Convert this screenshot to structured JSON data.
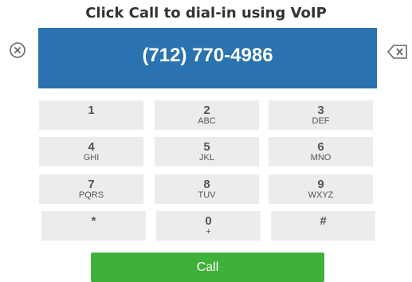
{
  "title": "Click Call to dial-in using VoIP",
  "display": {
    "number": "(712) 770-4986"
  },
  "keys": [
    {
      "digit": "1",
      "letters": ""
    },
    {
      "digit": "2",
      "letters": "ABC"
    },
    {
      "digit": "3",
      "letters": "DEF"
    },
    {
      "digit": "4",
      "letters": "GHI"
    },
    {
      "digit": "5",
      "letters": "JKL"
    },
    {
      "digit": "6",
      "letters": "MNO"
    },
    {
      "digit": "7",
      "letters": "PQRS"
    },
    {
      "digit": "8",
      "letters": "TUV"
    },
    {
      "digit": "9",
      "letters": "WXYZ"
    },
    {
      "digit": "*",
      "letters": ""
    },
    {
      "digit": "0",
      "letters": "+"
    },
    {
      "digit": "#",
      "letters": ""
    }
  ],
  "call_label": "Call",
  "icons": {
    "clear": "clear-circle-x-icon",
    "backspace": "backspace-icon"
  },
  "colors": {
    "display_bg": "#2a73b0",
    "call_bg": "#3fb03a",
    "key_bg": "#ececec"
  }
}
